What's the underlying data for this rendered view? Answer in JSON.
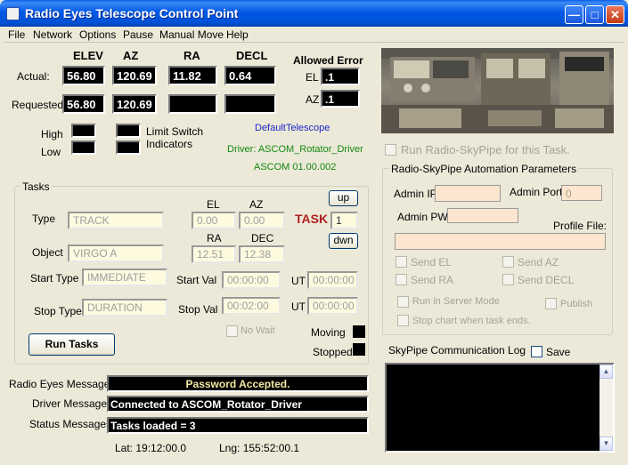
{
  "window": {
    "title": "Radio Eyes Telescope Control Point"
  },
  "menu": [
    "File",
    "Network",
    "Options",
    "Pause",
    "Manual Move",
    "Help"
  ],
  "coords": {
    "headers": {
      "elev": "ELEV",
      "az": "AZ",
      "ra": "RA",
      "decl": "DECL"
    },
    "actual_label": "Actual:",
    "requested_label": "Requested:",
    "actual": {
      "elev": "56.80",
      "az": "120.69",
      "ra": "11.82",
      "decl": "0.64"
    },
    "requested": {
      "elev": "56.80",
      "az": "120.69"
    }
  },
  "allowed_error": {
    "title": "Allowed Error",
    "el_label": "EL",
    "el_value": ".1",
    "az_label": "AZ",
    "az_value": ".1"
  },
  "limits": {
    "high": "High",
    "low": "Low",
    "indicator_label": "Limit Switch\nIndicators"
  },
  "telescope": {
    "name": "DefaultTelescope",
    "driver": "Driver: ASCOM_Rotator_Driver",
    "version": "ASCOM 01.00.002"
  },
  "tasks": {
    "title": "Tasks",
    "type_label": "Type",
    "type_value": "TRACK",
    "object_label": "Object",
    "object_value": "VIRGO A",
    "start_type_label": "Start Type",
    "start_type_value": "IMMEDIATE",
    "stop_type_label": "Stop Type",
    "stop_type_value": "DURATION",
    "el_label": "EL",
    "el_value": "0.00",
    "az_label": "AZ",
    "az_value": "0.00",
    "ra_label": "RA",
    "ra_value": "12.51",
    "dec_label": "DEC",
    "dec_value": "12.38",
    "task_label": "TASK",
    "task_number": "1",
    "up_label": "up",
    "down_label": "dwn",
    "start_val_label": "Start Val",
    "start_val": "00:00:00",
    "stop_val_label": "Stop Val",
    "stop_val": "00:02:00",
    "ut_label": "UT",
    "start_ut": "00:00:00",
    "stop_ut": "00:00:00",
    "no_wait_label": "No Wait",
    "moving_label": "Moving",
    "stopped_label": "Stopped",
    "run_button": "Run Tasks"
  },
  "messages": {
    "radio_eyes_label": "Radio Eyes Messages",
    "radio_eyes_value": "Password Accepted.",
    "driver_label": "Driver Messages",
    "driver_value": "Connected to ASCOM_Rotator_Driver",
    "status_label": "Status Messages",
    "status_value": "Tasks loaded =  3"
  },
  "location": {
    "lat": "Lat: 19:12:00.0",
    "lng": "Lng: 155:52:00.1"
  },
  "skypipe": {
    "run_label": "Run Radio-SkyPipe for this Task.",
    "group_title": "Radio-SkyPipe Automation Parameters",
    "admin_ip_label": "Admin IP:",
    "admin_ip_value": "",
    "admin_port_label": "Admin Port:",
    "admin_port_value": "0",
    "admin_pw_label": "Admin PW:",
    "admin_pw_value": "",
    "profile_label": "Profile File:",
    "profile_value": "",
    "send_el": "Send EL",
    "send_az": "Send AZ",
    "send_ra": "Send RA",
    "send_decl": "Send DECL",
    "server_mode": "Run in Server Mode",
    "publish": "Publish",
    "stop_chart": "Stop chart when task ends.",
    "log_label": "SkyPipe Communication Log",
    "save_label": "Save"
  },
  "colors": {
    "title_blue": "#0058e6",
    "telescope_blue": "#1a28c8",
    "driver_green": "#118811",
    "task_red": "#b02020"
  }
}
